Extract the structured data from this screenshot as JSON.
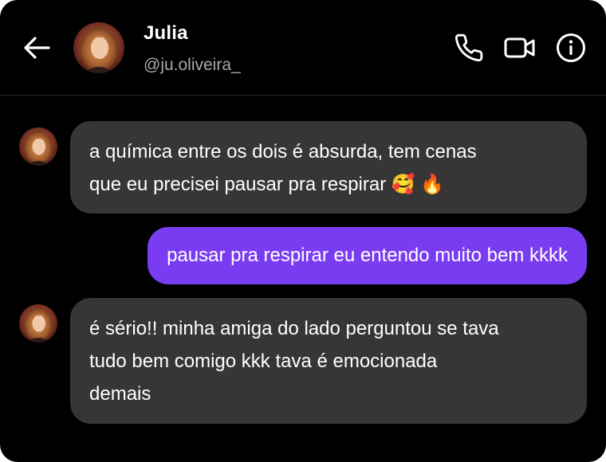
{
  "header": {
    "contact_name": "Julia",
    "contact_handle": "@ju.oliveira_",
    "icons": [
      "back-arrow-icon",
      "phone-icon",
      "video-camera-icon",
      "info-icon"
    ]
  },
  "messages": [
    {
      "direction": "incoming",
      "text": "a química entre os dois é absurda, tem cenas\nque eu precisei pausar pra respirar 🥰 🔥"
    },
    {
      "direction": "outgoing",
      "text": "pausar pra respirar eu entendo muito bem kkkk"
    },
    {
      "direction": "incoming",
      "text": "é sério!! minha amiga do lado perguntou se tava\ntudo bem comigo kkk tava é emocionada\ndemais"
    }
  ],
  "colors": {
    "background": "#000000",
    "incoming_bubble": "#363636",
    "outgoing_bubble": "#7a3cf0",
    "handle_text": "#a8a8a8"
  }
}
